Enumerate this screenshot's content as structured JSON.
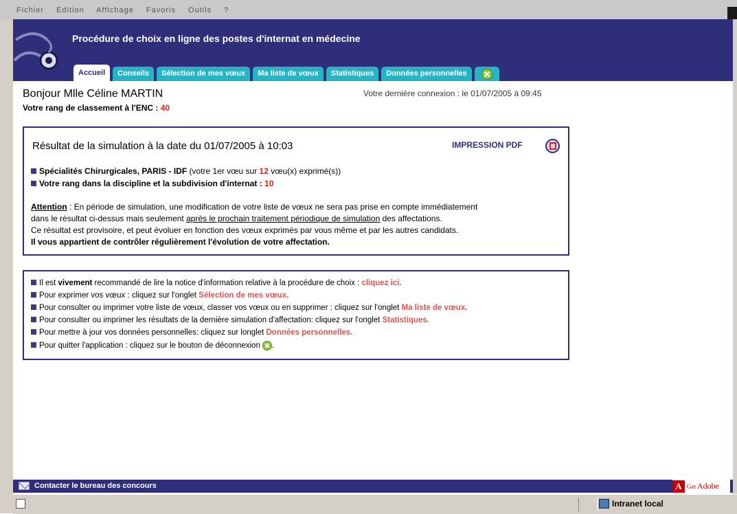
{
  "browser": {
    "menu": [
      "Fichier",
      "Edition",
      "Affichage",
      "Favoris",
      "Outils",
      "?"
    ]
  },
  "app": {
    "title": "Procédure de choix en ligne des postes d'internat en médecine"
  },
  "tabs": [
    {
      "label": "Accueil",
      "active": true
    },
    {
      "label": "Conseils"
    },
    {
      "label": "Sélection de mes vœux"
    },
    {
      "label": "Ma liste de vœux"
    },
    {
      "label": "Statistiques"
    },
    {
      "label": "Données personnelles"
    }
  ],
  "greeting": {
    "text": "Bonjour Mlle Céline MARTIN",
    "rank_label": "Votre rang de classement à l'ENC : ",
    "rank_value": "40",
    "last_connection": "Votre dernière connexion : le 01/07/2005 à 09:45"
  },
  "result": {
    "title": "Résultat de la simulation à la date du 01/07/2005 à 10:03",
    "print_label": "IMPRESSION PDF",
    "line1_bold": "Spécialités Chirurgicales, PARIS - IDF",
    "line1_pre": " (votre 1er vœu sur ",
    "line1_count": "12",
    "line1_post": " vœu(x) exprimé(s))",
    "line2_bold": "Votre rang dans la discipline et la subdivision d'internat : ",
    "line2_value": "10",
    "attention_label": "Attention",
    "attention_text": " : En période de simulation, une modification de votre liste de vœux ne sera pas prise en compte immédiatement",
    "attention_line2_pre": "dans le résultat ci-dessus mais seulement ",
    "attention_line2_underlined": "après le prochain traitement périodique de simulation",
    "attention_line2_post": " des affectations.",
    "attention_line3": "Ce résultat est provisoire, et peut évoluer en fonction des vœux exprimés par vous même et par les autres candidats.",
    "attention_line4": "Il vous appartient de contrôler régulièrement l'évolution de votre affectation."
  },
  "info": {
    "l1_pre": "Il est ",
    "l1_bold": "vivement",
    "l1_post": " recommandé de lire la notice d'information relative à la procédure de choix : ",
    "l1_link": "cliquez ici.",
    "l2_pre": "Pour exprimer vos vœux : cliquez sur l'onglet ",
    "l2_link": "Sélection de mes vœux.",
    "l3_pre": "Pour consulter ou imprimer votre liste de vœux, classer vos vœux ou en supprimer : cliquez sur l'onglet ",
    "l3_link": "Ma liste de vœux.",
    "l4_pre": "Pour consulter ou imprimer les résultats de la dernière simulation d'affectation: cliquez sur l'onglet ",
    "l4_link": "Statistiques.",
    "l5_pre": "Pour mettre à jour vos données personnelles: cliquez sur longlet ",
    "l5_link": "Données personnelles.",
    "l6_pre": "Pour quitter l'application : cliquez sur le bouton de déconnexion ",
    "l6_post": "."
  },
  "footer": {
    "contact": "Contacter le bureau des concours",
    "adobe_get": "Get",
    "adobe_brand": "Adobe"
  },
  "status": {
    "zone": "Intranet local"
  },
  "colors": {
    "header": "#2e2e7a",
    "tab": "#27b5c6",
    "accent_red": "#e02020",
    "link": "#e05050"
  }
}
